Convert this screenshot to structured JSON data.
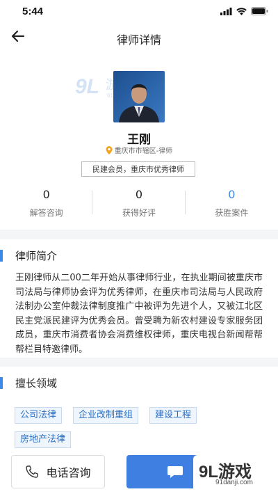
{
  "status_bar": {
    "time": "5:44"
  },
  "nav": {
    "title": "律师详情"
  },
  "watermark": {
    "text": "9L游戏",
    "url": "91danji.com"
  },
  "profile": {
    "name": "王刚",
    "location": "重庆市市辖区-律师",
    "tags": "民建会员，重庆市优秀律师"
  },
  "stats": [
    {
      "value": "0",
      "label": "解答咨询",
      "color": "#222222"
    },
    {
      "value": "0",
      "label": "获得好评",
      "color": "#222222"
    },
    {
      "value": "0",
      "label": "获胜案件",
      "color": "#3d8ae8"
    }
  ],
  "intro": {
    "title": "律师简介",
    "text": "王刚律师从二00二年开始从事律师行业，在执业期间被重庆市司法局与律师协会评为优秀律师，在重庆市司法局与人民政府法制办公室仲裁法律制度推广中被评为先进个人，又被江北区民主党派民建评为优秀会员。曾受聘为新农村建设专家服务团成员，重庆市消费者协会消费维权律师，重庆电视台新闻帮帮帮栏目特邀律师。"
  },
  "skills": {
    "title": "擅长领域",
    "items": [
      "公司法律",
      "企业改制重组",
      "建设工程",
      "房地产法律"
    ]
  },
  "bottom": {
    "call_label": "电话咨询"
  },
  "brand": {
    "logo_text": "9L游戏",
    "url": "91danji.com"
  },
  "colors": {
    "accent": "#3d8ae8",
    "button_blue": "#3f7fe2"
  }
}
